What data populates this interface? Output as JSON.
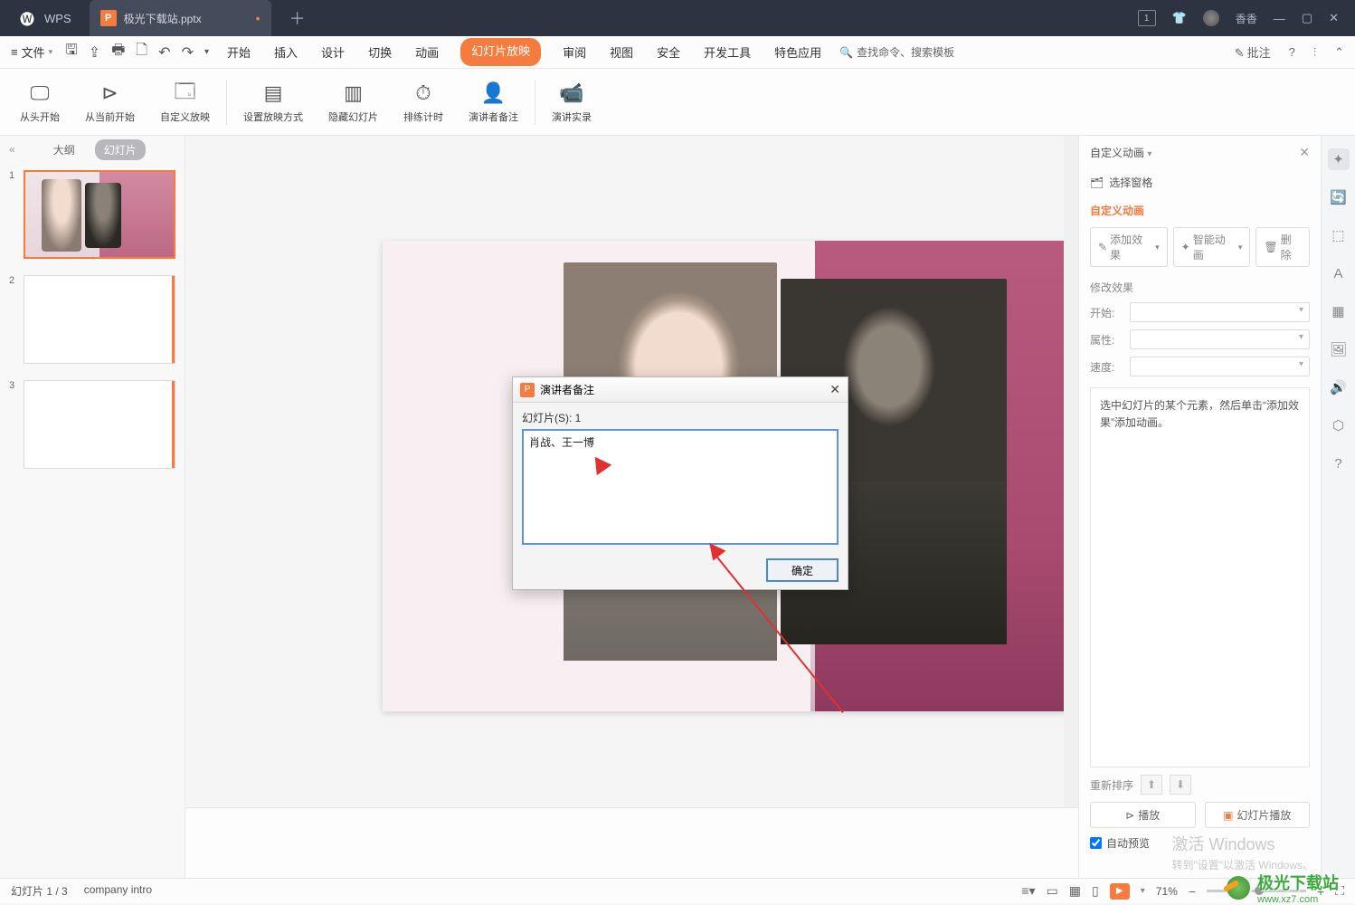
{
  "titlebar": {
    "app": "WPS",
    "tab_name": "极光下载站.pptx",
    "username": "香香"
  },
  "menubar": {
    "file": "文件",
    "tabs": [
      "开始",
      "插入",
      "设计",
      "切换",
      "动画",
      "幻灯片放映",
      "审阅",
      "视图",
      "安全",
      "开发工具",
      "特色应用"
    ],
    "active_index": 5,
    "search_placeholder": "查找命令、搜索模板",
    "approval": "批注"
  },
  "ribbon": {
    "items": [
      {
        "label": "从头开始"
      },
      {
        "label": "从当前开始"
      },
      {
        "label": "自定义放映"
      },
      {
        "label": "设置放映方式"
      },
      {
        "label": "隐藏幻灯片"
      },
      {
        "label": "排练计时"
      },
      {
        "label": "演讲者备注"
      },
      {
        "label": "演讲实录"
      }
    ]
  },
  "thumb": {
    "tab_outline": "大纲",
    "tab_slides": "幻灯片",
    "slides": [
      1,
      2,
      3
    ]
  },
  "dialog": {
    "title": "演讲者备注",
    "slide_label": "幻灯片(S): 1",
    "text": "肖战、王一博",
    "ok": "确定"
  },
  "rpanel": {
    "title": "自定义动画",
    "select_pane": "选择窗格",
    "section": "自定义动画",
    "btn_add": "添加效果",
    "btn_smart": "智能动画",
    "btn_delete": "删除",
    "modify_label": "修改效果",
    "row_start": "开始:",
    "row_prop": "属性:",
    "row_speed": "速度:",
    "hint": "选中幻灯片的某个元素，然后单击“添加效果”添加动画。",
    "reorder": "重新排序",
    "btn_play": "播放",
    "btn_slideshow": "幻灯片播放",
    "auto_preview": "自动预览"
  },
  "status": {
    "slide_info": "幻灯片 1 / 3",
    "template": "company intro",
    "zoom": "71%"
  },
  "watermark": {
    "activate": "激活 Windows",
    "activate_sub": "转到\"设置\"以激活 Windows。",
    "brand": "极光下载站",
    "url": "www.xz7.com"
  }
}
